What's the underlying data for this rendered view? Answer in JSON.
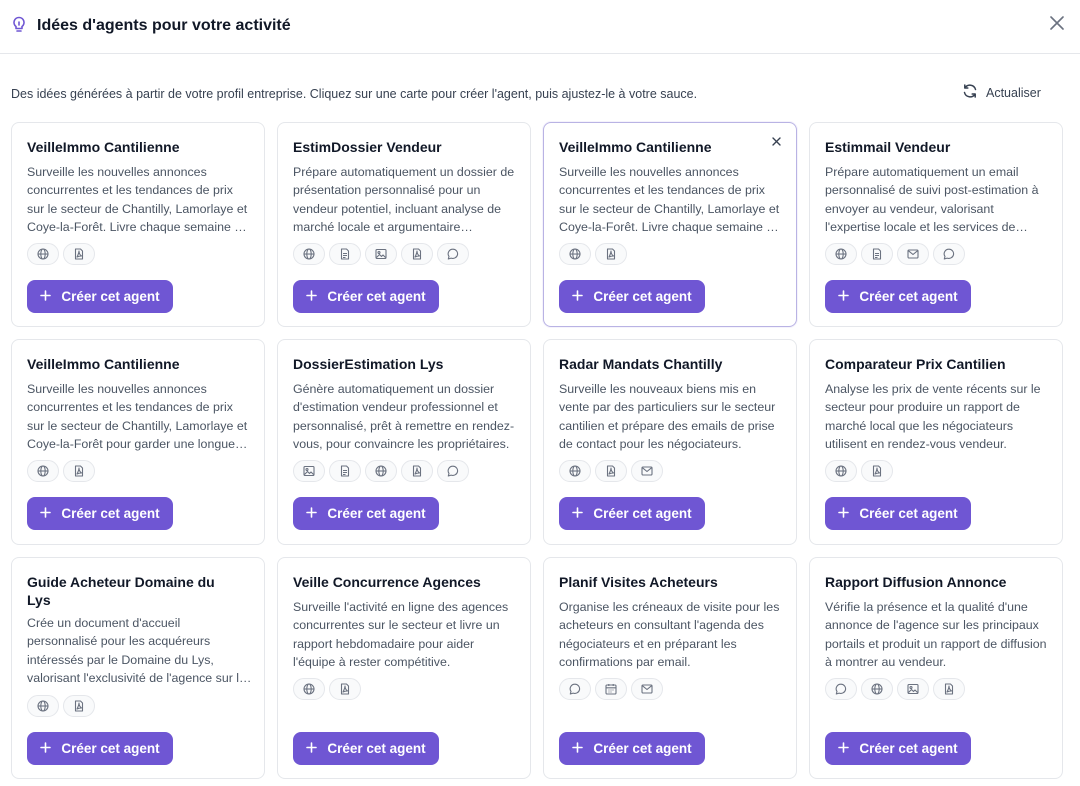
{
  "header": {
    "title": "Idées d'agents pour votre activité"
  },
  "subtitle": "Des idées générées à partir de votre profil entreprise. Cliquez sur une carte pour créer l'agent, puis ajustez-le à votre sauce.",
  "refresh_label": "Actualiser",
  "create_label": "Créer cet agent",
  "colors": {
    "accent": "#6f56d3",
    "card_border": "#e5e7eb",
    "selected_border": "#b9b3e4"
  },
  "cards": [
    {
      "title": "VeilleImmo Cantilienne",
      "description": "Surveille les nouvelles annonces concurrentes et les tendances de prix sur le secteur de Chantilly, Lamorlaye et Coye-la-Forêt. Livre chaque semaine un rapport synthétique.",
      "tools": [
        "globe-icon",
        "pdf-icon"
      ],
      "selected": false
    },
    {
      "title": "EstimDossier Vendeur",
      "description": "Prépare automatiquement un dossier de présentation personnalisé pour un vendeur potentiel, incluant analyse de marché locale et argumentaire commercial.",
      "tools": [
        "globe-icon",
        "document-icon",
        "image-icon",
        "pdf-icon",
        "chat-icon"
      ],
      "selected": false
    },
    {
      "title": "VeilleImmo Cantilienne",
      "description": "Surveille les nouvelles annonces concurrentes et les tendances de prix sur le secteur de Chantilly, Lamorlaye et Coye-la-Forêt. Livre chaque semaine un rapport synthétique.",
      "tools": [
        "globe-icon",
        "pdf-icon"
      ],
      "selected": true
    },
    {
      "title": "Estimmail Vendeur",
      "description": "Prépare automatiquement un email personnalisé de suivi post-estimation à envoyer au vendeur, valorisant l'expertise locale et les services de l'agence.",
      "tools": [
        "globe-icon",
        "document-icon",
        "mail-icon",
        "chat-icon"
      ],
      "selected": false
    },
    {
      "title": "VeilleImmo Cantilienne",
      "description": "Surveille les nouvelles annonces concurrentes et les tendances de prix sur le secteur de Chantilly, Lamorlaye et Coye-la-Forêt pour garder une longueur d'avance.",
      "tools": [
        "globe-icon",
        "pdf-icon"
      ],
      "selected": false
    },
    {
      "title": "DossierEstimation Lys",
      "description": "Génère automatiquement un dossier d'estimation vendeur professionnel et personnalisé, prêt à remettre en rendez-vous, pour convaincre les propriétaires.",
      "tools": [
        "image-icon",
        "document-icon",
        "globe-icon",
        "pdf-icon",
        "chat-icon"
      ],
      "selected": false
    },
    {
      "title": "Radar Mandats Chantilly",
      "description": "Surveille les nouveaux biens mis en vente par des particuliers sur le secteur cantilien et prépare des emails de prise de contact pour les négociateurs.",
      "tools": [
        "globe-icon",
        "pdf-icon",
        "mail-icon"
      ],
      "selected": false
    },
    {
      "title": "Comparateur Prix Cantilien",
      "description": "Analyse les prix de vente récents sur le secteur pour produire un rapport de marché local que les négociateurs utilisent en rendez-vous vendeur.",
      "tools": [
        "globe-icon",
        "pdf-icon"
      ],
      "selected": false
    },
    {
      "title": "Guide Acheteur Domaine du Lys",
      "description": "Crée un document d'accueil personnalisé pour les acquéreurs intéressés par le Domaine du Lys, valorisant l'exclusivité de l'agence sur le secteur.",
      "tools": [
        "globe-icon",
        "pdf-icon"
      ],
      "selected": false
    },
    {
      "title": "Veille Concurrence Agences",
      "description": "Surveille l'activité en ligne des agences concurrentes sur le secteur et livre un rapport hebdomadaire pour aider l'équipe à rester compétitive.",
      "tools": [
        "globe-icon",
        "pdf-icon"
      ],
      "selected": false
    },
    {
      "title": "Planif Visites Acheteurs",
      "description": "Organise les créneaux de visite pour les acheteurs en consultant l'agenda des négociateurs et en préparant les confirmations par email.",
      "tools": [
        "chat-icon",
        "calendar-icon",
        "mail-icon"
      ],
      "selected": false
    },
    {
      "title": "Rapport Diffusion Annonce",
      "description": "Vérifie la présence et la qualité d'une annonce de l'agence sur les principaux portails et produit un rapport de diffusion à montrer au vendeur.",
      "tools": [
        "chat-icon",
        "globe-icon",
        "image-icon",
        "pdf-icon"
      ],
      "selected": false
    }
  ]
}
